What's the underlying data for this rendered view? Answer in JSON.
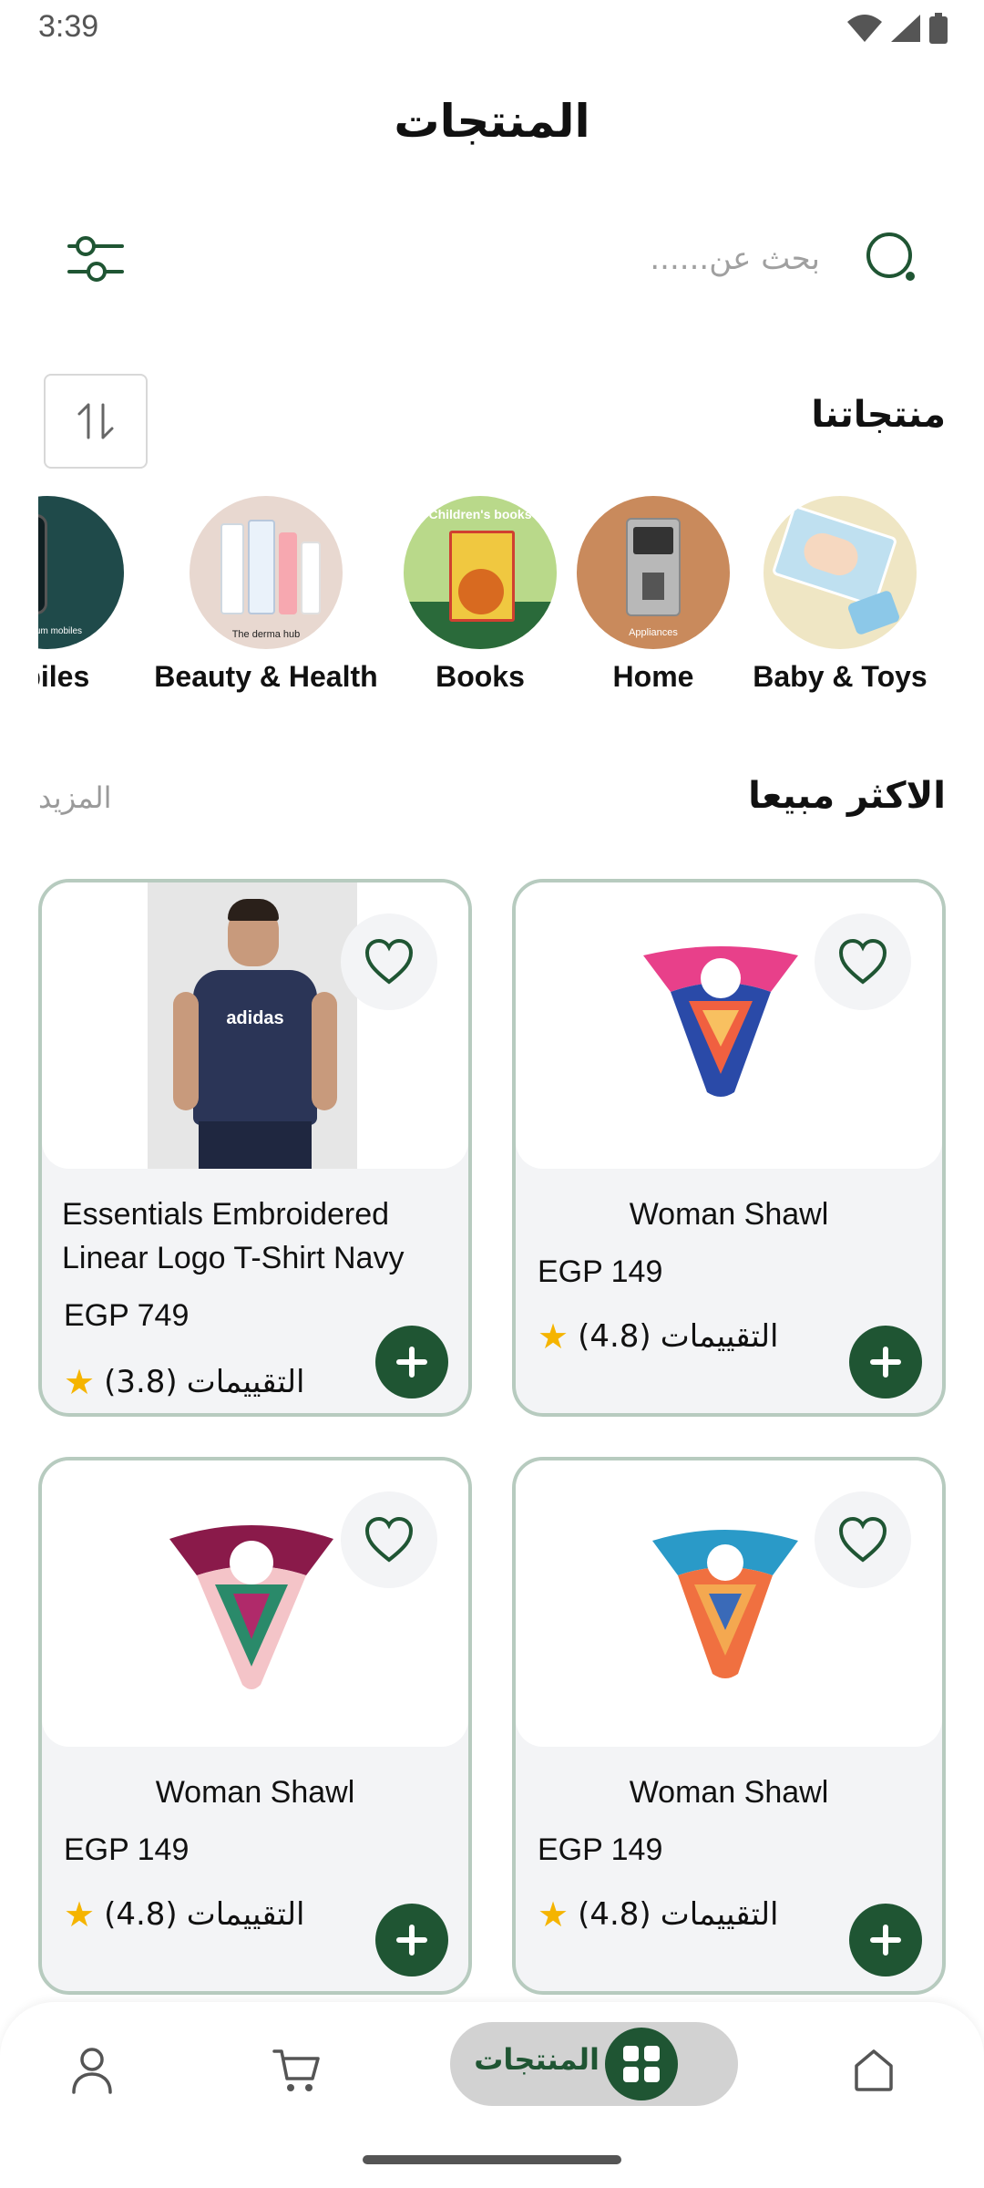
{
  "status": {
    "time": "3:39"
  },
  "header": {
    "title": "المنتجات"
  },
  "search": {
    "placeholder": "بحث عن......"
  },
  "sections": {
    "our_products": "منتجاتنا",
    "best_selling": "الاكثر مبيعا",
    "more": "المزيد"
  },
  "categories": [
    {
      "label": "Mobiles",
      "display": "obiles",
      "overlay": "premium mobiles"
    },
    {
      "label": "Beauty & Health",
      "overlay": "The derma hub"
    },
    {
      "label": "Books",
      "overlay": "Children's books"
    },
    {
      "label": "Home",
      "overlay": "Appliances"
    },
    {
      "label": "Baby & Toys"
    }
  ],
  "products": [
    {
      "name": "Essentials Embroidered Linear Logo T-Shirt Navy",
      "price": "EGP 749",
      "rating": "(3.8)",
      "rating_label": "التقييمات",
      "image": "adidas-tshirt"
    },
    {
      "name": "Woman Shawl",
      "price": "EGP 149",
      "rating": "(4.8)",
      "rating_label": "التقييمات",
      "image": "shawl-pink-blue"
    },
    {
      "name": "Woman Shawl",
      "price": "EGP 149",
      "rating": "(4.8)",
      "rating_label": "التقييمات",
      "image": "shawl-maroon"
    },
    {
      "name": "Woman Shawl",
      "price": "EGP 149",
      "rating": "(4.8)",
      "rating_label": "التقييمات",
      "image": "shawl-orange-blue"
    }
  ],
  "nav": {
    "active_label": "المنتجات",
    "items": [
      "profile-icon",
      "cart-icon",
      "products-grid-icon",
      "home-icon"
    ]
  },
  "colors": {
    "primary": "#1f5533",
    "card_border": "#b7cbbf",
    "card_bg": "#f3f4f6",
    "star": "#f5b400"
  }
}
